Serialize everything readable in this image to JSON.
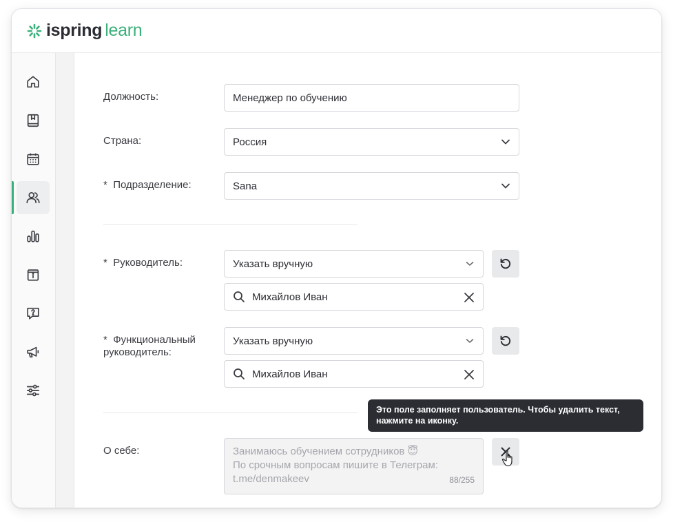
{
  "app": {
    "logo_part1": "ispring",
    "logo_part2": "learn",
    "brand_color": "#3bb07a"
  },
  "sidebar": {
    "items": [
      {
        "icon": "home-icon"
      },
      {
        "icon": "book-icon"
      },
      {
        "icon": "calendar-icon"
      },
      {
        "icon": "users-icon",
        "active": true
      },
      {
        "icon": "chart-icon"
      },
      {
        "icon": "info-card-icon"
      },
      {
        "icon": "question-icon"
      },
      {
        "icon": "megaphone-icon"
      },
      {
        "icon": "sliders-icon"
      }
    ]
  },
  "form": {
    "position": {
      "label": "Должность:",
      "value": "Менеджер по обучению"
    },
    "country": {
      "label": "Страна:",
      "value": "Россия"
    },
    "department": {
      "required_mark": "*",
      "label": "Подразделение:",
      "value": "Sana"
    },
    "manager": {
      "required_mark": "*",
      "label": "Руководитель:",
      "mode": "Указать вручную",
      "search_value": "Михайлов Иван"
    },
    "functional_manager": {
      "required_mark": "*",
      "label_line1": "Функциональный",
      "label_line2": "руководитель:",
      "mode": "Указать вручную",
      "search_value": "Михайлов Иван"
    },
    "about": {
      "label": "О себе:",
      "line1": "Занимаюсь обучением сотрудников 😇",
      "line2": "По срочным вопросам пишите в Телеграм:",
      "line3": "t.me/denmakeev",
      "counter": "88/255"
    }
  },
  "tooltip": {
    "line1": "Это поле заполняет пользователь. Чтобы удалить текст,",
    "line2": "нажмите на иконку."
  }
}
